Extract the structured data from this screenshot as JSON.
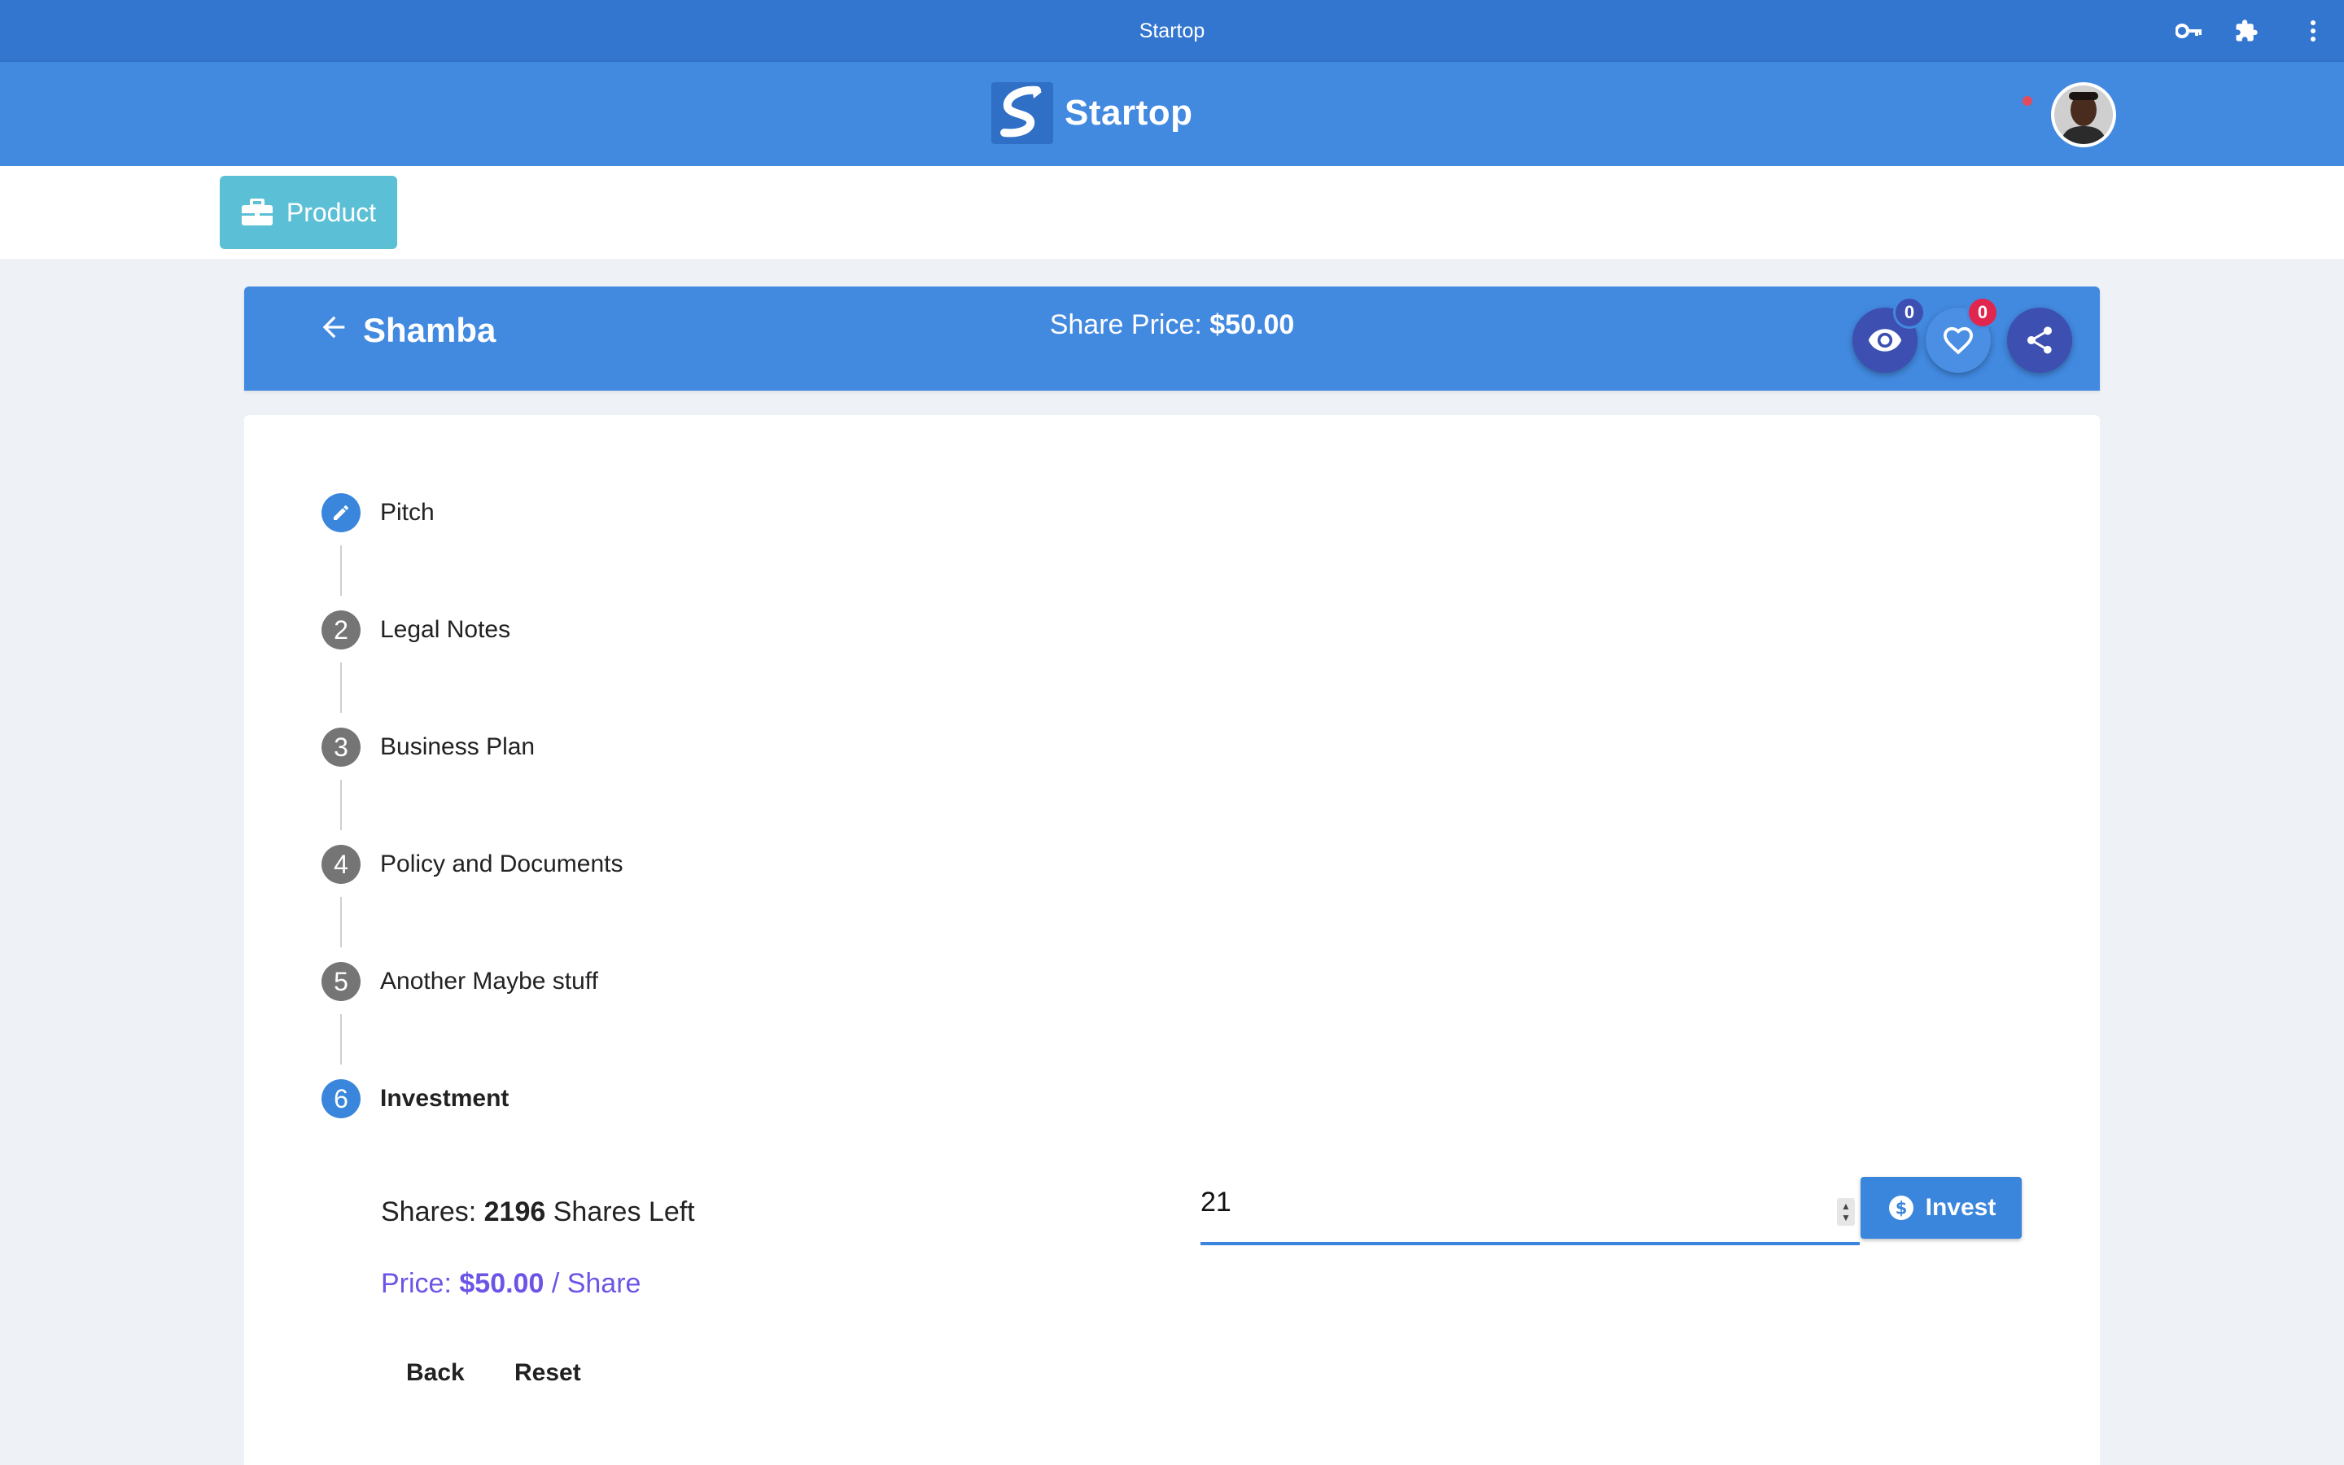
{
  "browser": {
    "title": "Startop",
    "icons": [
      "key-icon",
      "puzzle-icon",
      "more-vert-icon"
    ]
  },
  "header": {
    "brand_name": "Startop"
  },
  "tabs": {
    "product_label": "Product"
  },
  "product": {
    "name": "Shamba",
    "share_price_label": "Share Price:",
    "share_price_value": "$50.00",
    "views_count": "0",
    "likes_count": "0"
  },
  "steps": [
    {
      "number": "",
      "label": "Pitch",
      "state": "edit"
    },
    {
      "number": "2",
      "label": "Legal Notes",
      "state": "inactive"
    },
    {
      "number": "3",
      "label": "Business Plan",
      "state": "inactive"
    },
    {
      "number": "4",
      "label": "Policy and Documents",
      "state": "inactive"
    },
    {
      "number": "5",
      "label": "Another Maybe stuff",
      "state": "inactive"
    },
    {
      "number": "6",
      "label": "Investment",
      "state": "active"
    }
  ],
  "investment": {
    "shares_prefix": "Shares:",
    "shares_left": "2196",
    "shares_suffix": "Shares Left",
    "price_prefix": "Price:",
    "price_value": "$50.00",
    "price_suffix": "/ Share",
    "quantity_value": "21",
    "invest_label": "Invest",
    "back_label": "Back",
    "reset_label": "Reset"
  },
  "colors": {
    "chrome": "#3276cf",
    "primary": "#4289e0",
    "fab_dark": "#3d4fb0",
    "product_tab": "#5bc0d6",
    "price_text": "#6a55e6",
    "badge_red": "#e0264f"
  }
}
